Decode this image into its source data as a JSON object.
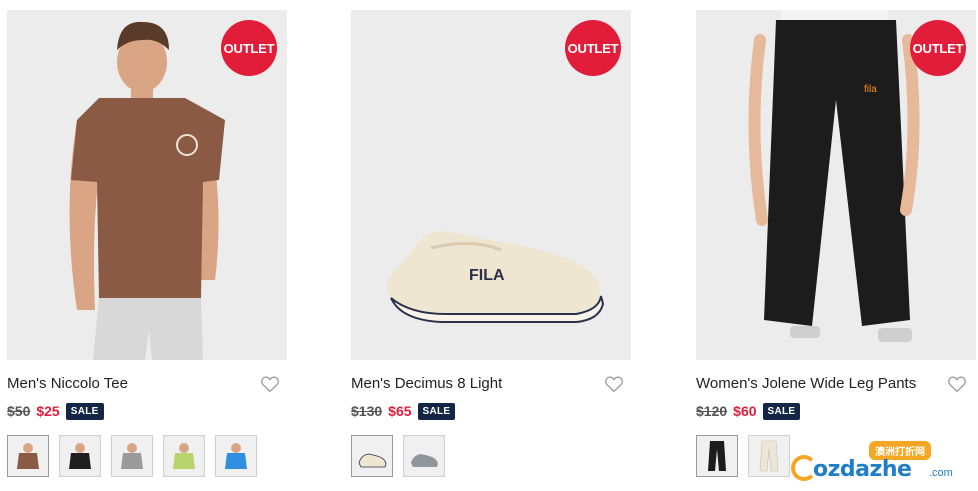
{
  "products": [
    {
      "badge": "OUTLET",
      "name": "Men's Niccolo Tee",
      "was_price": "$50",
      "now_price": "$25",
      "sale_label": "SALE",
      "image_icon": "tee-icon",
      "swatches": [
        "#8a5a44",
        "#1f1f1f",
        "#9a9a9a",
        "#b7d36b",
        "#2f8fe0"
      ]
    },
    {
      "badge": "OUTLET",
      "name": "Men's Decimus 8 Light",
      "was_price": "$130",
      "now_price": "$65",
      "sale_label": "SALE",
      "image_icon": "sneaker-icon",
      "swatches": [
        "#efe6d2",
        "#8f979c"
      ]
    },
    {
      "badge": "OUTLET",
      "name": "Women's Jolene Wide Leg Pants",
      "was_price": "$120",
      "now_price": "$60",
      "sale_label": "SALE",
      "image_icon": "pants-icon",
      "swatches": [
        "#1c1c1c",
        "#ece6d8"
      ]
    }
  ],
  "watermark": {
    "top": "澳洲打折网",
    "main": "ozdazhe",
    "domain": ".com"
  },
  "colors": {
    "badge_red": "#e11d3a",
    "sale_navy": "#132645",
    "image_bg": "#ececec"
  }
}
